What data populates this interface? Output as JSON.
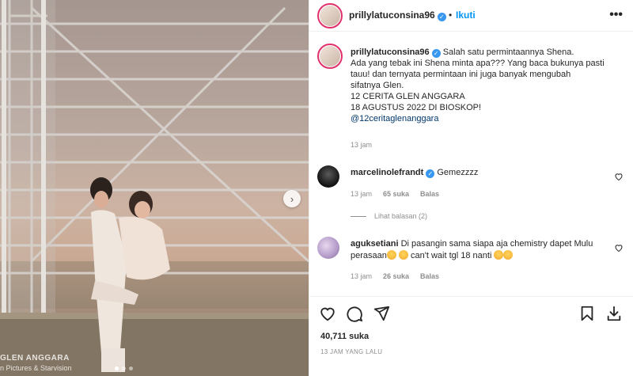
{
  "media": {
    "watermark_title": "GLEN ANGGARA",
    "watermark_credit": "n Pictures & Starvision",
    "carousel_count": 3,
    "carousel_active": 0
  },
  "header": {
    "username": "prillylatuconsina96",
    "separator": "•",
    "follow_label": "Ikuti",
    "more_label": "•••"
  },
  "caption": {
    "username": "prillylatuconsina96",
    "first_line": "Salah satu permintaannya Shena.",
    "lines": [
      "Ada yang tebak ini Shena minta apa??? Yang baca bukunya pasti",
      "tauu! dan ternyata permintaan ini juga banyak mengubah",
      "sifatnya Glen.",
      "12 CERITA GLEN ANGGARA",
      "18 AGUSTUS 2022 DI BIOSKOP!"
    ],
    "mention": "@12ceritaglenanggara",
    "time": "13 jam"
  },
  "comments": [
    {
      "username": "marcelinolefrandt",
      "text": "Gemezzzz",
      "time": "13 jam",
      "likes": "65 suka",
      "reply_label": "Balas",
      "view_replies": "Lihat balasan (2)"
    },
    {
      "username": "aguksetiani",
      "text_line1": "Di pasangin sama siapa aja chemistry dapet Mulu",
      "text_line2_a": "perasaan",
      "text_line2_b": "can't wait tgl 18 nanti",
      "time": "13 jam",
      "likes": "26 suka",
      "reply_label": "Balas"
    }
  ],
  "actions": {
    "likes": "40,711 suka",
    "post_time": "13 JAM YANG LALU"
  },
  "colors": {
    "accent": "#0095f6",
    "verified": "#3897f0",
    "muted": "#8e8e8e"
  }
}
